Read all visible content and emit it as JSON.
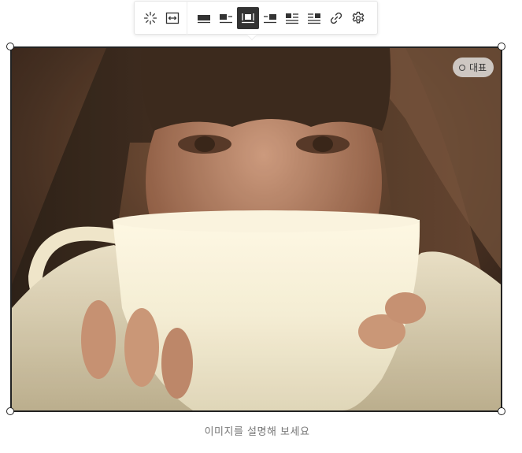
{
  "toolbar": {
    "buttons": [
      {
        "name": "effect-sparkle-icon",
        "group": 1
      },
      {
        "name": "fit-width-icon",
        "group": 1
      },
      {
        "name": "align-full-icon",
        "group": 2
      },
      {
        "name": "align-left-icon",
        "group": 2
      },
      {
        "name": "align-center-icon",
        "group": 2,
        "active": true
      },
      {
        "name": "align-right-icon",
        "group": 2
      },
      {
        "name": "wrap-left-icon",
        "group": 2
      },
      {
        "name": "wrap-right-icon",
        "group": 2
      },
      {
        "name": "link-icon",
        "group": 2
      },
      {
        "name": "settings-gear-icon",
        "group": 2
      }
    ]
  },
  "image": {
    "representative_label": "대표"
  },
  "caption": {
    "placeholder": "이미지를 설명해 보세요"
  }
}
